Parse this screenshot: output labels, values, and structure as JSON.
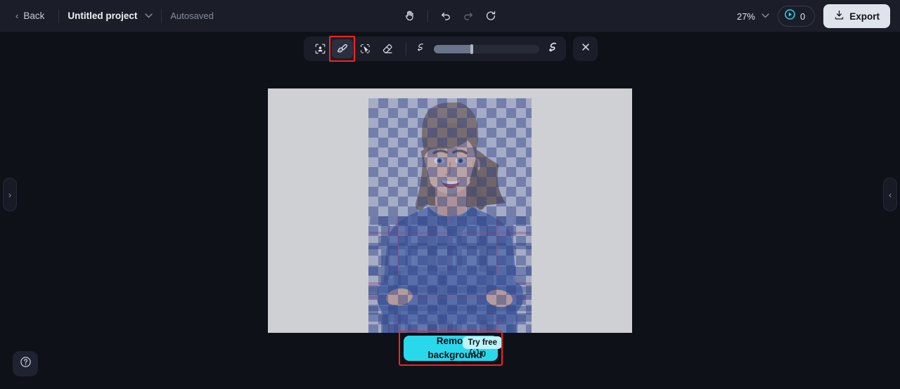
{
  "topbar": {
    "back_label": "Back",
    "project_name": "Untitled project",
    "project_caret": "⌄",
    "autosave_status": "Autosaved",
    "zoom_level": "27%",
    "zoom_caret": "⌄",
    "credits_count": "0",
    "export_label": "Export",
    "tools": [
      {
        "name": "hand-tool",
        "title": "Hand"
      },
      {
        "name": "undo",
        "title": "Undo"
      },
      {
        "name": "redo",
        "title": "Redo"
      },
      {
        "name": "reset",
        "title": "Reset"
      }
    ]
  },
  "edit_toolbar": {
    "tools": [
      {
        "name": "auto-subject-select",
        "label": "Auto select subject",
        "active": false
      },
      {
        "name": "brush",
        "label": "Brush",
        "active": true
      },
      {
        "name": "magic-select",
        "label": "Magic select",
        "active": false
      },
      {
        "name": "eraser",
        "label": "Eraser",
        "active": false
      }
    ],
    "brush_size_small_label": "Small brush",
    "brush_size_large_label": "Large brush",
    "brush_size_value": 36,
    "close_label": "Close"
  },
  "canvas": {
    "background_color": "#cfd0d3",
    "mask_tint_color": "#465aaa",
    "subject_description": "Woman with arms crossed wearing plaid shirt, selection mask shown as checkerboard overlay"
  },
  "side_panels": {
    "left_toggle_icon": "›",
    "right_toggle_icon": "‹"
  },
  "help": {
    "icon": "?"
  },
  "remove_bg": {
    "label_line1": "Remove",
    "label_line2": "background",
    "coin_count": "0",
    "badge_label": "Try free",
    "button_color": "#2ad8ec",
    "badge_color": "#bdf3fb"
  },
  "annotations": {
    "highlight_color": "#f5241d",
    "targets": [
      "brush-tool",
      "remove-background-button"
    ]
  }
}
